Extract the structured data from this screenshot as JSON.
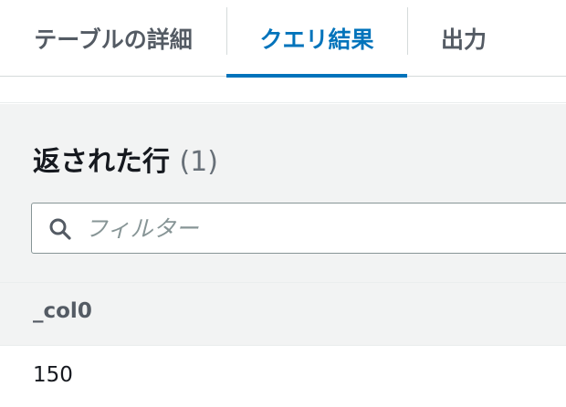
{
  "tabs": [
    {
      "label": "テーブルの詳細",
      "active": false
    },
    {
      "label": "クエリ結果",
      "active": true
    },
    {
      "label": "出力",
      "active": false
    }
  ],
  "results": {
    "title": "返された行",
    "count": "(1)",
    "filter_placeholder": "フィルター",
    "columns": [
      "_col0"
    ],
    "rows": [
      [
        "150"
      ]
    ]
  },
  "colors": {
    "accent": "#0073bb",
    "text": "#16191f",
    "muted": "#545b64",
    "panel_bg": "#f2f3f3"
  }
}
